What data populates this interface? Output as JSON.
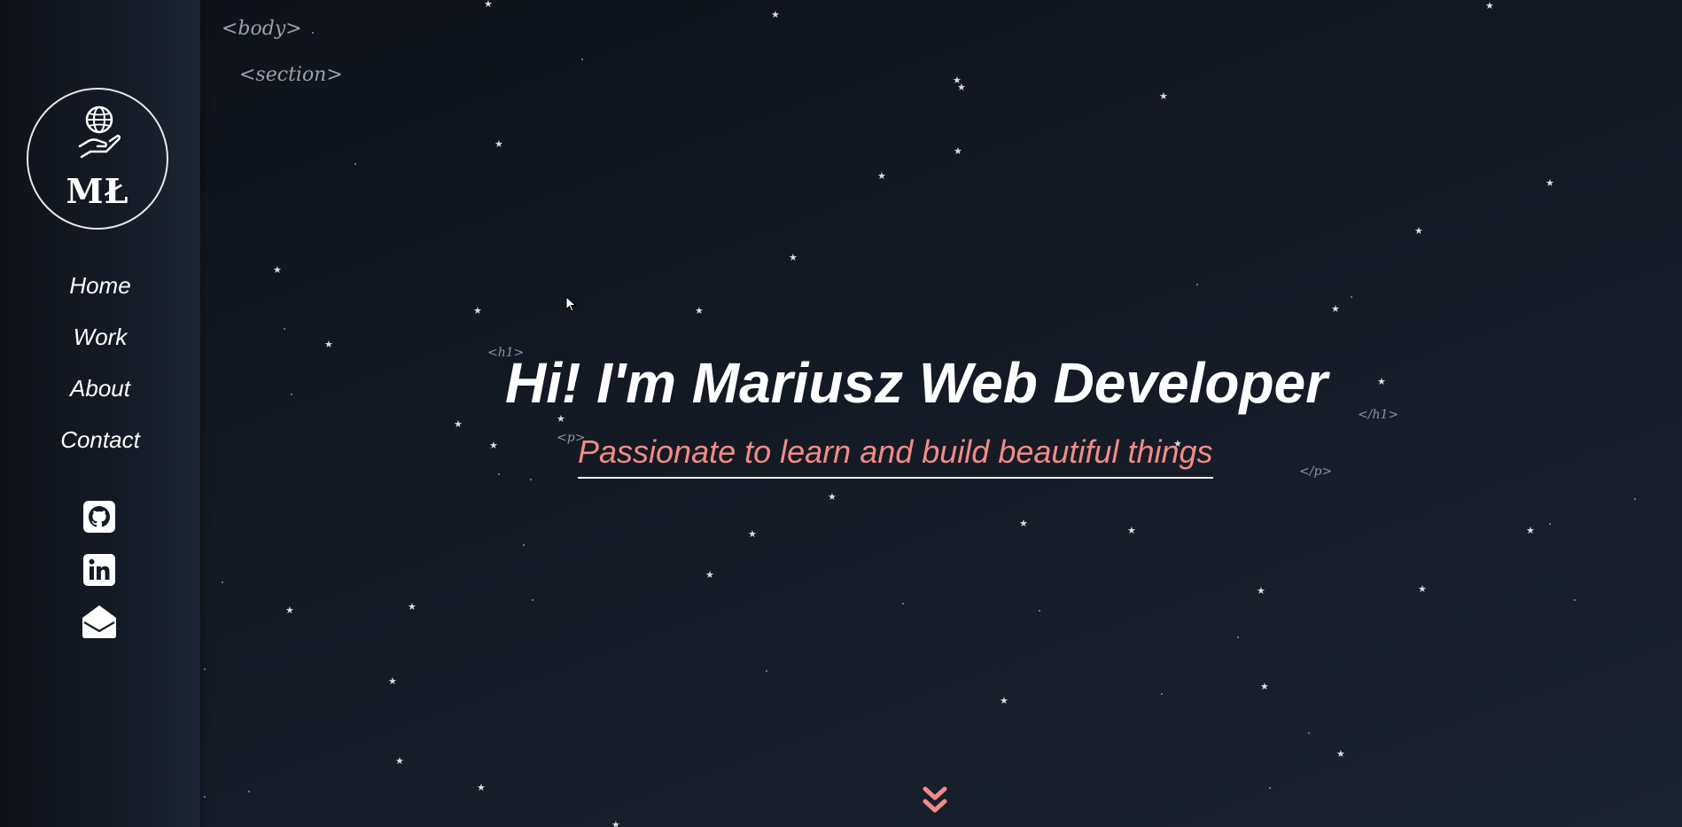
{
  "tags": {
    "body": "<body>",
    "section": "<section>",
    "h1_open": "<h1>",
    "h1_close": "</h1>",
    "p_open": "<p>",
    "p_close": "</p>"
  },
  "logo": {
    "text": "MŁ",
    "icon": "globe-hand-icon"
  },
  "nav": {
    "items": [
      {
        "label": "Home"
      },
      {
        "label": "Work"
      },
      {
        "label": "About"
      },
      {
        "label": "Contact"
      }
    ]
  },
  "social": {
    "icons": [
      "github-icon",
      "linkedin-icon",
      "mail-icon"
    ]
  },
  "hero": {
    "title": "Hi! I'm Mariusz Web Developer",
    "subtitle": "Passionate to learn and build beautiful things"
  },
  "scroll": {
    "icon": "chevron-double-down-icon"
  },
  "colors": {
    "background": "#131821",
    "accent": "#f28b86",
    "text": "#ffffff",
    "tag": "#9aa0ab"
  }
}
